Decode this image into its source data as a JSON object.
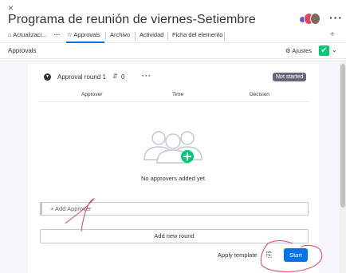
{
  "header": {
    "close_glyph": "×",
    "title": "Programa de reunión de viernes-Setiembre",
    "more_glyph": "···"
  },
  "tabs": [
    {
      "label": "Actualizaci...",
      "icon": "home-icon"
    },
    {
      "label": "Approvals",
      "icon": "star-icon",
      "active": true
    },
    {
      "label": "Archivo"
    },
    {
      "label": "Actividad"
    },
    {
      "label": "Ficha del elemento"
    }
  ],
  "tabs_more": "···",
  "tabs_add": "+",
  "toolbar": {
    "label": "Approvals",
    "settings_label": "Ajustes",
    "check_glyph": "✔",
    "chevron": "⌄"
  },
  "round": {
    "name": "Approval round 1",
    "count": "0",
    "dots": "···",
    "status": "Not started"
  },
  "columns": [
    "Approver",
    "Time",
    "Decision"
  ],
  "empty_text": "No approvers added yet",
  "add_approver_placeholder": "+ Add Approver",
  "add_round_label": "Add new round",
  "apply_template_label": "Apply template",
  "start_label": "Start",
  "colors": {
    "accent": "#0073ea",
    "success": "#00ca72",
    "status_badge": "#676879",
    "annotation": "#e2445c"
  }
}
